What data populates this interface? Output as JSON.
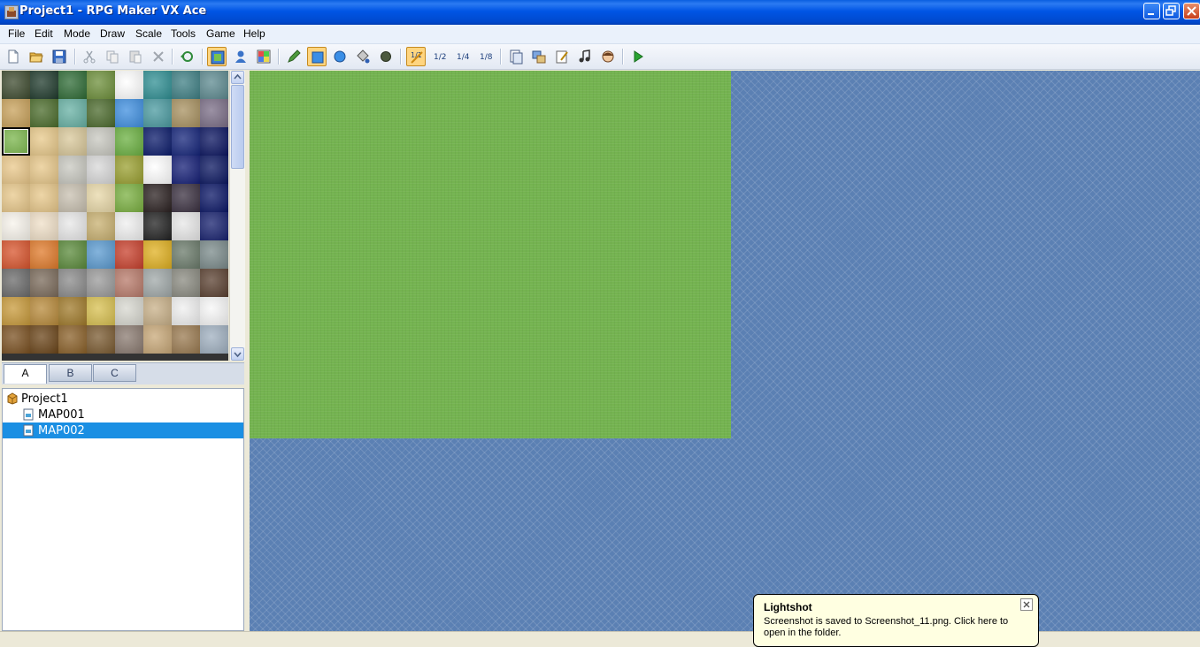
{
  "window": {
    "title": "Project1 - RPG Maker VX Ace"
  },
  "menu": [
    "File",
    "Edit",
    "Mode",
    "Draw",
    "Scale",
    "Tools",
    "Game",
    "Help"
  ],
  "toolbar": {
    "icons": [
      "new-project-icon",
      "open-project-icon",
      "save-project-icon",
      "cut-icon",
      "copy-icon",
      "paste-icon",
      "delete-icon",
      "undo-icon",
      "map-layer-icon",
      "event-layer-icon",
      "region-icon",
      "pencil-icon",
      "rectangle-icon",
      "ellipse-icon",
      "flood-fill-icon",
      "shadow-pen-icon",
      "zoom-1-1-icon",
      "zoom-1-2-icon",
      "zoom-1-4-icon",
      "zoom-1-8-icon",
      "database-icon",
      "resource-manager-icon",
      "script-editor-icon",
      "sound-test-icon",
      "character-generator-icon",
      "playtest-icon"
    ],
    "zoom_labels": [
      "1/1",
      "1/2",
      "1/4",
      "1/8"
    ]
  },
  "palette": {
    "tabs": [
      "A",
      "B",
      "C"
    ],
    "active_tab": "A"
  },
  "map_tree": {
    "project": "Project1",
    "maps": [
      "MAP001",
      "MAP002"
    ],
    "selected": "MAP002"
  },
  "colors": {
    "grass": "#74b350",
    "void": "#5b80b3",
    "selection": "#1a8fe3",
    "titlebar": "#0055e5"
  },
  "notification": {
    "title": "Lightshot",
    "text": "Screenshot is saved to Screenshot_11.png. Click here to open in the folder."
  }
}
